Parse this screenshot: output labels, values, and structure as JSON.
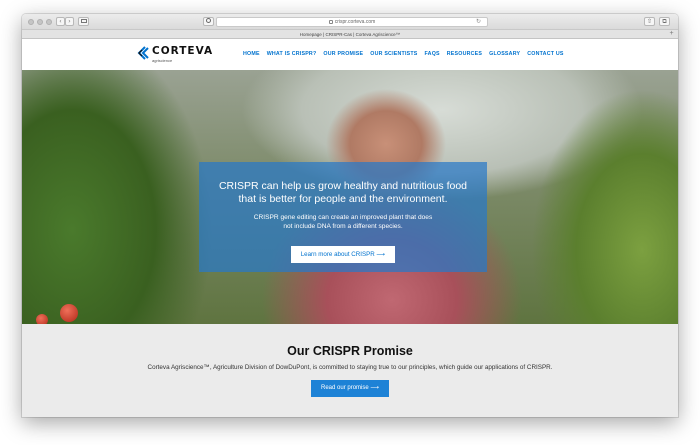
{
  "browser": {
    "url": "crispr.corteva.com",
    "tab_title": "Homepage | CRISPR-Cas | Corteva Agriscience™",
    "back": "‹",
    "forward": "›",
    "reload": "↻",
    "share": "⇧",
    "tabs_icon": "⧉",
    "new_tab": "+"
  },
  "site": {
    "brand": "CORTEVA",
    "brand_sub": "agriscience",
    "nav": [
      "HOME",
      "WHAT IS CRISPR?",
      "OUR PROMISE",
      "OUR SCIENTISTS",
      "FAQS",
      "RESOURCES",
      "GLOSSARY",
      "CONTACT US"
    ],
    "active_nav": "HOME",
    "accent_color": "#0072ce"
  },
  "hero": {
    "headline_line1": "CRISPR can help us grow healthy and nutritious food",
    "headline_line2": "that is better for people and the environment.",
    "sub_line1": "CRISPR gene editing can create an improved plant that does",
    "sub_line2": "not include DNA from a different species.",
    "button_label": "Learn more about CRISPR  ⟶"
  },
  "promise": {
    "title": "Our CRISPR Promise",
    "text": "Corteva Agriscience™, Agriculture Division of DowDuPont, is committed to staying true to our principles, which guide our applications of CRISPR.",
    "button_label": "Read our promise  ⟶"
  }
}
